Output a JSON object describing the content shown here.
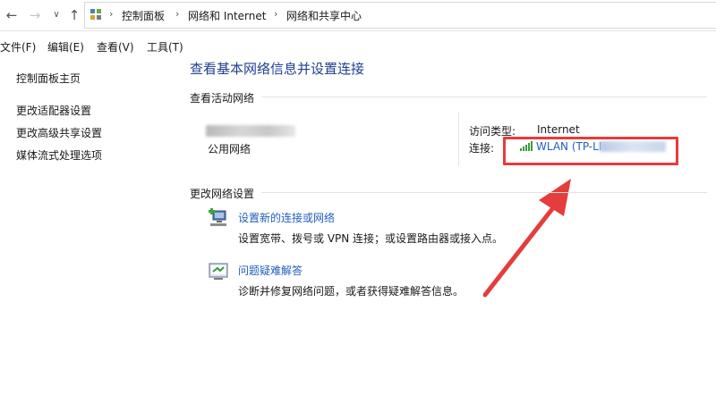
{
  "address_bar": {
    "breadcrumbs": [
      "控制面板",
      "网络和 Internet",
      "网络和共享中心"
    ]
  },
  "menu": {
    "file": "文件(F)",
    "edit": "编辑(E)",
    "view": "查看(V)",
    "tools": "工具(T)"
  },
  "sidebar": {
    "items": [
      {
        "label": "控制面板主页"
      },
      {
        "label": "更改适配器设置"
      },
      {
        "label": "更改高级共享设置"
      },
      {
        "label": "媒体流式处理选项"
      }
    ]
  },
  "main": {
    "title": "查看基本网络信息并设置连接",
    "active_network": {
      "heading": "查看活动网络",
      "network_type": "公用网络",
      "access_type_label": "访问类型:",
      "access_type_value": "Internet",
      "connection_label": "连接:",
      "connection_value": "WLAN (TP-LI"
    },
    "change_settings": {
      "heading": "更改网络设置",
      "tasks": [
        {
          "link": "设置新的连接或网络",
          "desc": "设置宽带、拨号或 VPN 连接；或设置路由器或接入点。"
        },
        {
          "link": "问题疑难解答",
          "desc": "诊断并修复网络问题，或者获得疑难解答信息。"
        }
      ]
    }
  },
  "colors": {
    "title_blue": "#1f3f8f",
    "link_blue": "#1f5fbf",
    "annotation_red": "#e53c3c",
    "signal_green": "#3a9a3a"
  },
  "icons": [
    "back-arrow-icon",
    "forward-arrow-icon",
    "recent-dropdown-icon",
    "up-arrow-icon",
    "control-panel-icon",
    "wifi-signal-icon",
    "new-connection-icon",
    "troubleshoot-icon"
  ]
}
